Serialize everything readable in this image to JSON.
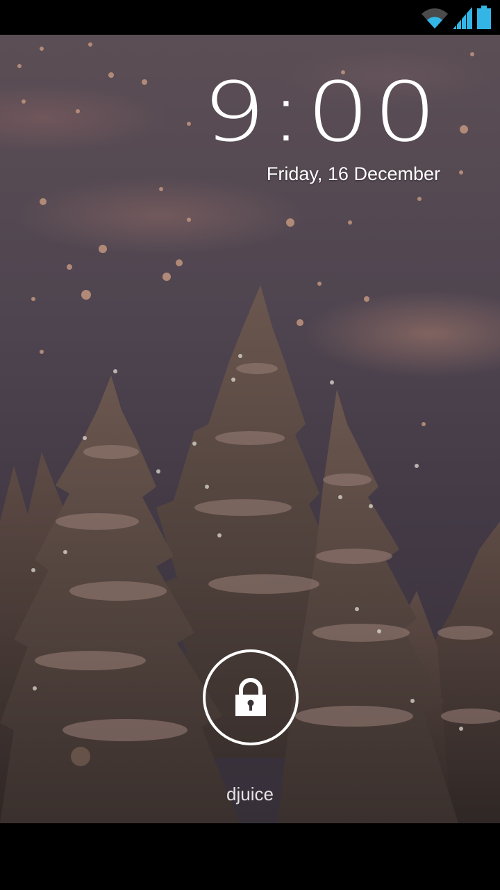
{
  "status_bar": {
    "icons": [
      "wifi-icon",
      "signal-icon",
      "battery-icon"
    ],
    "icon_color": "#33b5e5"
  },
  "lockscreen": {
    "time": "9:00",
    "date": "Friday, 16 December",
    "carrier": "djuice"
  },
  "wallpaper": {
    "description_icons": [
      "snowy-pine-trees",
      "snowflakes"
    ],
    "sky_color": "#4f4550",
    "tree_color": "#4a3d39"
  },
  "lock_button": {
    "icon": "lock-icon",
    "ring_color": "#ffffff"
  }
}
